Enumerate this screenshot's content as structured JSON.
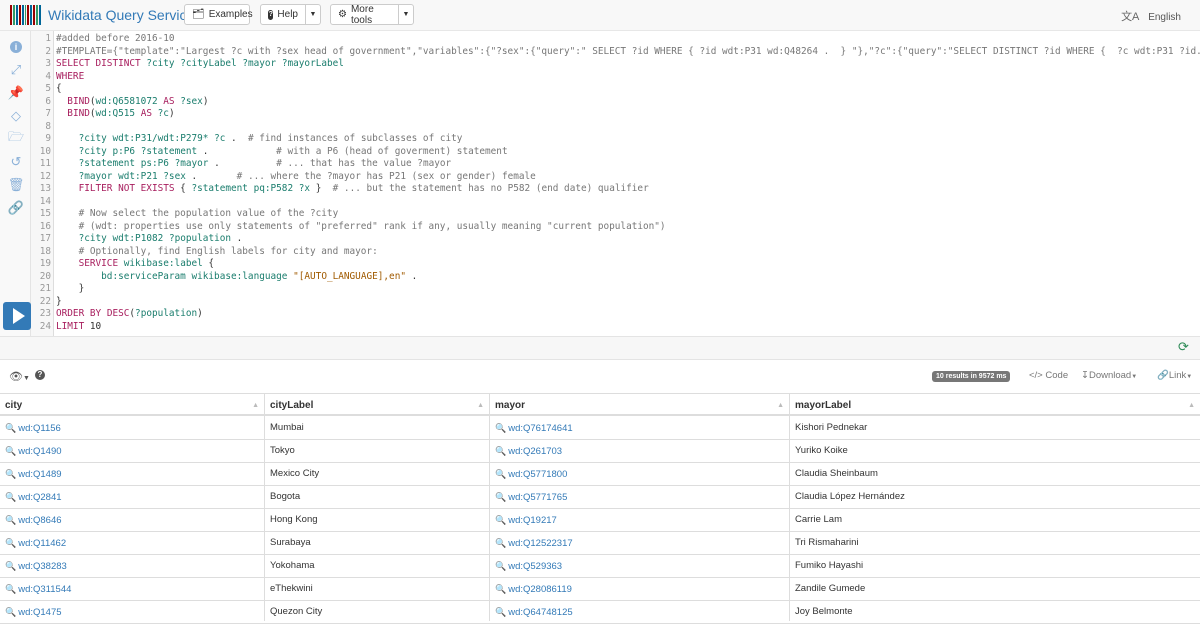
{
  "app": {
    "title": "Wikidata Query Service"
  },
  "nav": {
    "examples_label": "Examples",
    "help_label": "Help",
    "more_tools_label": "More tools",
    "language_label": "English"
  },
  "colors": {
    "accent": "#337ab7",
    "run_button": "#337ab7",
    "refresh": "#2e8b57"
  },
  "toolbar": {
    "icons": [
      "info-icon",
      "expand-icon",
      "prefix-icon",
      "diamond-icon",
      "folder-icon",
      "history-icon",
      "trash-icon",
      "link-icon"
    ]
  },
  "editor": {
    "lines": [
      "#added before 2016-10",
      "#TEMPLATE={\"template\":\"Largest ?c with ?sex head of government\",\"variables\":{\"?sex\":{\"query\":\" SELECT ?id WHERE { ?id wdt:P31 wd:Q48264 .  } \"},\"?c\":{\"query\":\"SELECT DISTINCT ?id WHERE {  ?c wdt:P31 ?id.  ?c p:P6 ?mayor. }\"} } }",
      "SELECT DISTINCT ?city ?cityLabel ?mayor ?mayorLabel",
      "WHERE",
      "{",
      "  BIND(wd:Q6581072 AS ?sex)",
      "  BIND(wd:Q515 AS ?c)",
      "",
      "    ?city wdt:P31/wdt:P279* ?c .  # find instances of subclasses of city",
      "    ?city p:P6 ?statement .            # with a P6 (head of goverment) statement",
      "    ?statement ps:P6 ?mayor .          # ... that has the value ?mayor",
      "    ?mayor wdt:P21 ?sex .       # ... where the ?mayor has P21 (sex or gender) female",
      "    FILTER NOT EXISTS { ?statement pq:P582 ?x }  # ... but the statement has no P582 (end date) qualifier",
      "",
      "    # Now select the population value of the ?city",
      "    # (wdt: properties use only statements of \"preferred\" rank if any, usually meaning \"current population\")",
      "    ?city wdt:P1082 ?population .",
      "    # Optionally, find English labels for city and mayor:",
      "    SERVICE wikibase:label {",
      "        bd:serviceParam wikibase:language \"[AUTO_LANGUAGE],en\" .",
      "    }",
      "}",
      "ORDER BY DESC(?population)",
      "LIMIT 10"
    ]
  },
  "results": {
    "badge": "10 results in 9572 ms",
    "code_label": "Code",
    "download_label": "Download",
    "link_label": "Link",
    "columns": [
      "city",
      "cityLabel",
      "mayor",
      "mayorLabel"
    ],
    "rows": [
      [
        "wd:Q1156",
        "Mumbai",
        "wd:Q76174641",
        "Kishori Pednekar"
      ],
      [
        "wd:Q1490",
        "Tokyo",
        "wd:Q261703",
        "Yuriko Koike"
      ],
      [
        "wd:Q1489",
        "Mexico City",
        "wd:Q5771800",
        "Claudia Sheinbaum"
      ],
      [
        "wd:Q2841",
        "Bogota",
        "wd:Q5771765",
        "Claudia López Hernández"
      ],
      [
        "wd:Q8646",
        "Hong Kong",
        "wd:Q19217",
        "Carrie Lam"
      ],
      [
        "wd:Q11462",
        "Surabaya",
        "wd:Q12522317",
        "Tri Rismaharini"
      ],
      [
        "wd:Q38283",
        "Yokohama",
        "wd:Q529363",
        "Fumiko Hayashi"
      ],
      [
        "wd:Q311544",
        "eThekwini",
        "wd:Q28086119",
        "Zandile Gumede"
      ],
      [
        "wd:Q1475",
        "Quezon City",
        "wd:Q64748125",
        "Joy Belmonte"
      ]
    ]
  }
}
